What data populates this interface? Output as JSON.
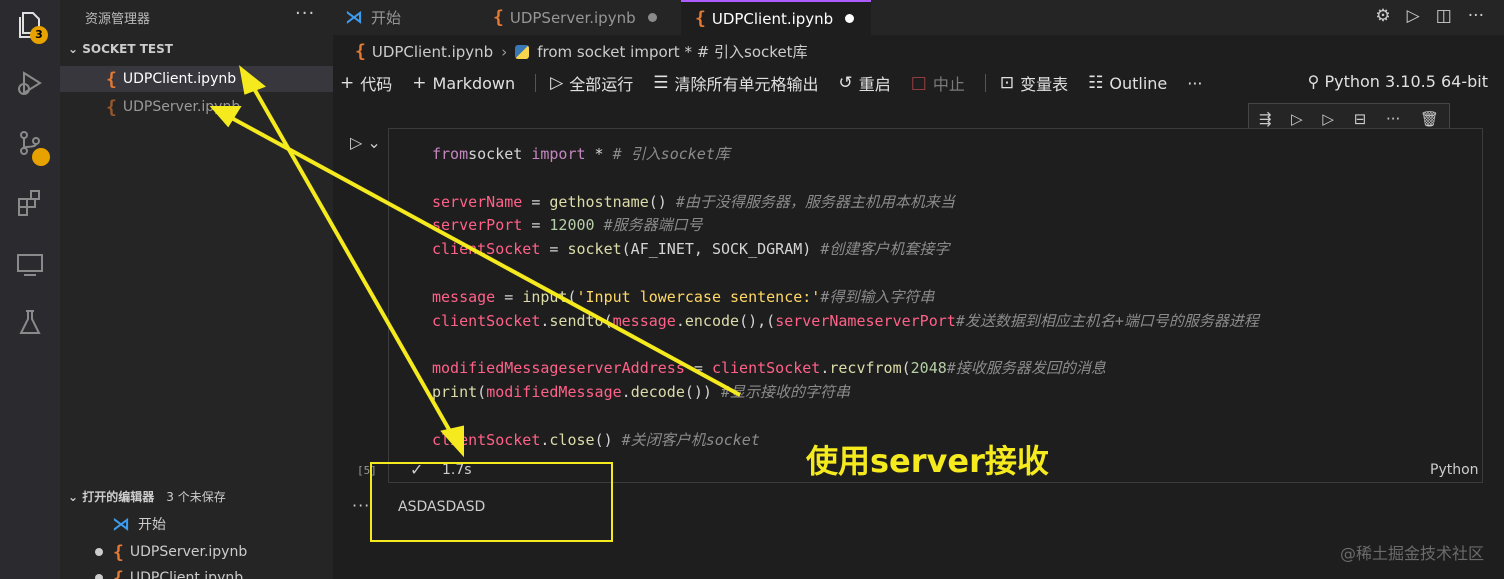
{
  "activity_bar": {
    "explorer_badge": "3"
  },
  "sidebar": {
    "title": "资源管理器",
    "more": "···",
    "section_title": "SOCKET TEST",
    "files": [
      {
        "name": "UDPClient.ipynb",
        "color": "#ffffff"
      },
      {
        "name": "UDPServer.ipynb",
        "color": "#9a9a9a"
      }
    ],
    "open_editors": {
      "title": "打开的编辑器",
      "unsaved": "3 个未保存",
      "items": [
        {
          "name": "开始"
        },
        {
          "name": "UDPServer.ipynb"
        },
        {
          "name": "UDPClient.ipynb"
        }
      ]
    }
  },
  "tabs": [
    {
      "label": "开始",
      "active": false
    },
    {
      "label": "UDPServer.ipynb",
      "active": false,
      "dot_color": "#8a8a8a"
    },
    {
      "label": "UDPClient.ipynb",
      "active": true,
      "dot_color": "#ffffff"
    }
  ],
  "breadcrumb": {
    "file": "UDPClient.ipynb",
    "cell": "from socket import * # 引入socket库"
  },
  "toolbar": {
    "code": "代码",
    "markdown": "Markdown",
    "run_all": "全部运行",
    "clear_outputs": "清除所有单元格输出",
    "restart": "重启",
    "interrupt": "中止",
    "variables": "变量表",
    "outline": "Outline",
    "more": "···",
    "kernel": "Python 3.10.5 64-bit"
  },
  "cell": {
    "lines": [
      {
        "parts": [
          [
            "kw",
            "from"
          ],
          [
            "",
            "socket "
          ],
          [
            "kw",
            "import"
          ],
          [
            "",
            " * "
          ],
          [
            "cm",
            "# 引入socket库"
          ]
        ]
      },
      {
        "parts": [
          [
            "",
            ""
          ]
        ]
      },
      {
        "parts": [
          [
            "var",
            "serverName"
          ],
          [
            "",
            " = "
          ],
          [
            "fn",
            "gethostname"
          ],
          [
            "",
            "() "
          ],
          [
            "cm",
            "#由于没得服务器，服务器主机用本机来当"
          ]
        ]
      },
      {
        "parts": [
          [
            "var",
            "serverPort"
          ],
          [
            "",
            " = "
          ],
          [
            "num",
            "12000"
          ],
          [
            "",
            " "
          ],
          [
            "cm",
            "#服务器端口号"
          ]
        ]
      },
      {
        "parts": [
          [
            "var",
            "clientSocket"
          ],
          [
            "",
            " = "
          ],
          [
            "fn",
            "socket"
          ],
          [
            "",
            "(AF_INET, SOCK_DGRAM) "
          ],
          [
            "cm",
            "#创建客户机套接字"
          ]
        ]
      },
      {
        "parts": [
          [
            "",
            ""
          ]
        ]
      },
      {
        "parts": [
          [
            "var",
            "message"
          ],
          [
            "",
            " = "
          ],
          [
            "fn",
            "input"
          ],
          [
            "",
            "("
          ],
          [
            "str",
            "'Input lowercase sentence:'"
          ],
          [
            ") "
          ],
          [
            "cm",
            "#得到输入字符串"
          ]
        ]
      },
      {
        "parts": [
          [
            "var",
            "clientSocket"
          ],
          [
            "",
            "."
          ],
          [
            "fn",
            "sendto"
          ],
          [
            "",
            "("
          ],
          [
            "var",
            "message"
          ],
          [
            "",
            "."
          ],
          [
            "fn",
            "encode"
          ],
          [
            "",
            "(),("
          ],
          [
            "var",
            "serverName"
          ],
          [
            ", "
          ],
          [
            "var",
            "serverPort"
          ],
          [
            ")) "
          ],
          [
            "cm",
            "#发送数据到相应主机名+端口号的服务器进程"
          ]
        ]
      },
      {
        "parts": [
          [
            "",
            ""
          ]
        ]
      },
      {
        "parts": [
          [
            "var",
            "modifiedMessage"
          ],
          [
            ", "
          ],
          [
            "var",
            "serverAddress"
          ],
          [
            "",
            " = "
          ],
          [
            "var",
            "clientSocket"
          ],
          [
            "",
            "."
          ],
          [
            "fn",
            "recvfrom"
          ],
          [
            "",
            "("
          ],
          [
            "num",
            "2048"
          ],
          [
            ") "
          ],
          [
            "cm",
            "#接收服务器发回的消息"
          ]
        ]
      },
      {
        "parts": [
          [
            "fn",
            "print"
          ],
          [
            "",
            "("
          ],
          [
            "var",
            "modifiedMessage"
          ],
          [
            "",
            "."
          ],
          [
            "fn",
            "decode"
          ],
          [
            "",
            "()) "
          ],
          [
            "cm",
            "#显示接收的字符串"
          ]
        ]
      },
      {
        "parts": [
          [
            "",
            ""
          ]
        ]
      },
      {
        "parts": [
          [
            "var",
            "clientSocket"
          ],
          [
            "",
            "."
          ],
          [
            "fn",
            "close"
          ],
          [
            "",
            "() "
          ],
          [
            "cm",
            "#关闭客户机socket"
          ]
        ]
      }
    ],
    "exec_count": "[5]",
    "duration": "1.7s",
    "language": "Python",
    "output": "ASDASDASD"
  },
  "annotation": {
    "text": "使用server接收",
    "color": "#f4ea1d"
  },
  "watermark": "@稀土掘金技术社区"
}
